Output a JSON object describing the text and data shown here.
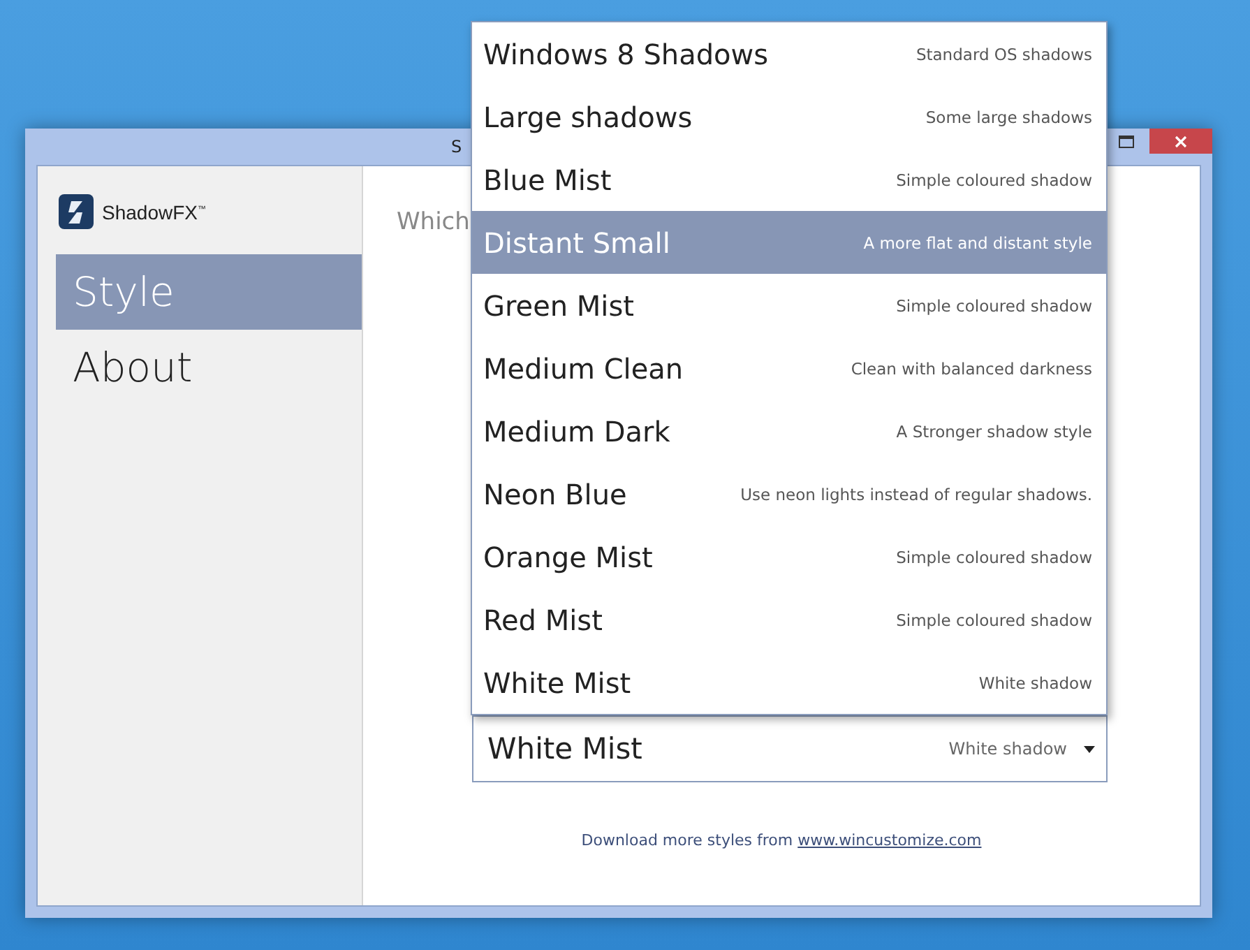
{
  "window": {
    "title": "S"
  },
  "sidebar": {
    "logo": "ShadowFX$^{™}$",
    "items": [
      {
        "label": "Style",
        "selected": true
      },
      {
        "label": "About",
        "selected": false
      }
    ]
  },
  "main": {
    "prompt": "Which",
    "style_dropdown": {
      "value": "White Mist",
      "description": "White shadow",
      "expanded": true,
      "options": [
        {
          "name": "Windows 8 Shadows",
          "description": "Standard OS shadows",
          "highlighted": false
        },
        {
          "name": "Large shadows",
          "description": "Some large shadows",
          "highlighted": false
        },
        {
          "name": "Blue Mist",
          "description": "Simple coloured shadow",
          "highlighted": false
        },
        {
          "name": "Distant Small",
          "description": "A more flat and distant style",
          "highlighted": true
        },
        {
          "name": "Green Mist",
          "description": "Simple coloured shadow",
          "highlighted": false
        },
        {
          "name": "Medium Clean",
          "description": "Clean with balanced darkness",
          "highlighted": false
        },
        {
          "name": "Medium Dark",
          "description": "A Stronger shadow style",
          "highlighted": false
        },
        {
          "name": "Neon Blue",
          "description": "Use neon lights instead of regular shadows.",
          "highlighted": false
        },
        {
          "name": "Orange Mist",
          "description": "Simple coloured shadow",
          "highlighted": false
        },
        {
          "name": "Red Mist",
          "description": "Simple coloured shadow",
          "highlighted": false
        },
        {
          "name": "White Mist",
          "description": "White shadow",
          "highlighted": false
        }
      ]
    },
    "footer": {
      "text": "Download more styles from",
      "link": "www.wincustomize.com"
    }
  }
}
